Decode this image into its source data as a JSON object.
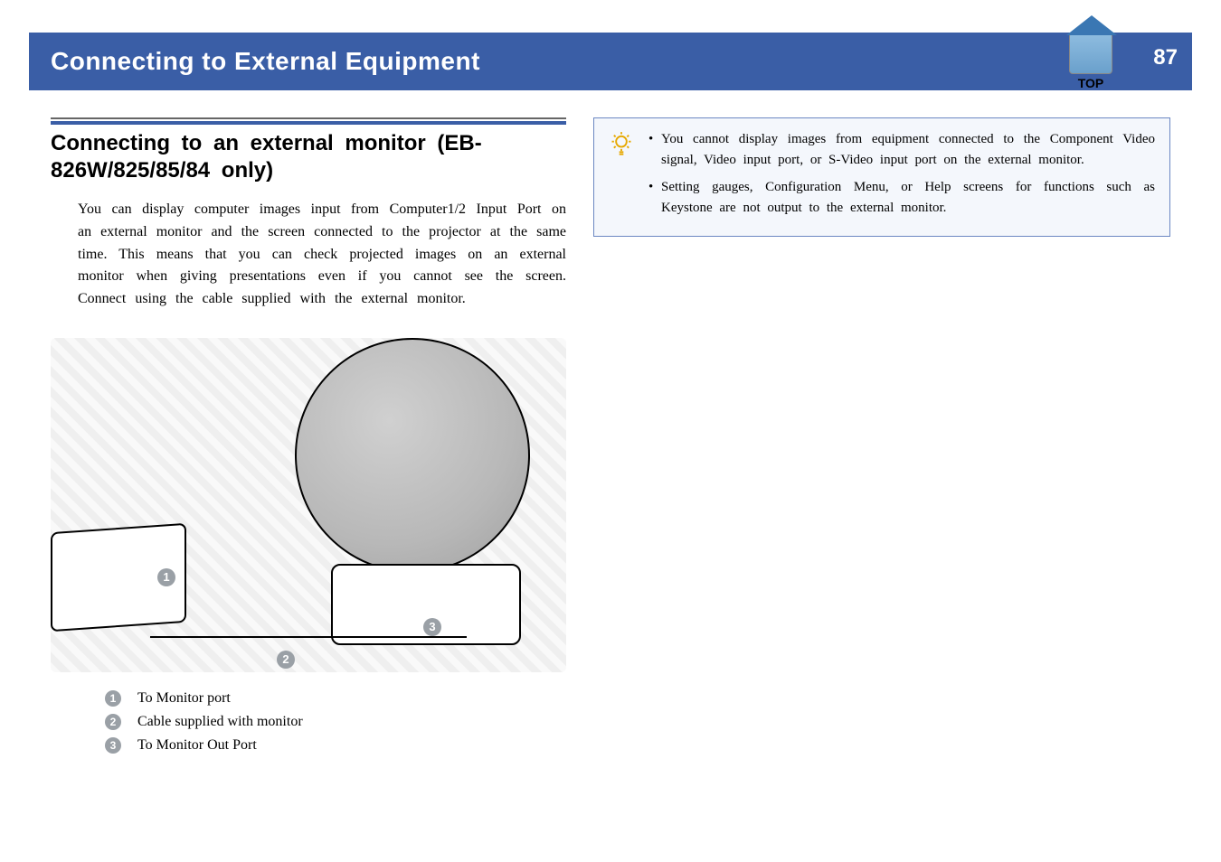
{
  "header": {
    "title": "Connecting to External Equipment",
    "page_number": "87",
    "top_label": "TOP"
  },
  "section": {
    "heading": "Connecting to an external monitor (EB-826W/825/85/84 only)",
    "body": "You can display computer images input from Computer1/2 Input Port on an external monitor and the screen connected to the projector at the same time. This means that you can check projected images on an external monitor when giving presentations even if you cannot see the screen. Connect using the cable supplied with the external monitor."
  },
  "callouts": {
    "n1": "1",
    "n2": "2",
    "n3": "3"
  },
  "legend": {
    "items": [
      {
        "num": "1",
        "text": "To Monitor port"
      },
      {
        "num": "2",
        "text": "Cable supplied with monitor"
      },
      {
        "num": "3",
        "text": "To Monitor Out Port"
      }
    ]
  },
  "tipbox": {
    "bullets": [
      "You cannot display images from equipment connected to the Component Video signal, Video input port, or S-Video input port on the external monitor.",
      "Setting gauges, Configuration Menu, or Help screens for functions such as Keystone are not output to the external monitor."
    ]
  }
}
